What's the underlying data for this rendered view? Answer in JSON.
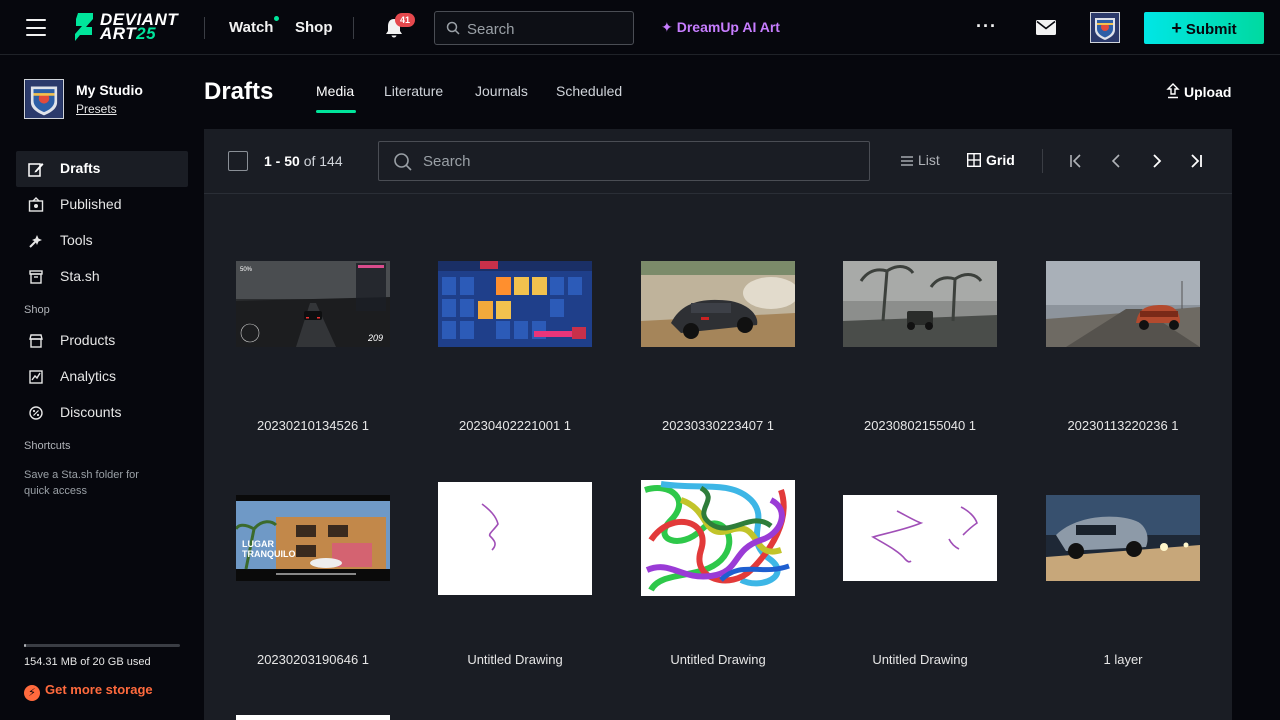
{
  "topbar": {
    "logo_line1": "DEVIANT",
    "logo_line2": "ART",
    "logo_num": "25",
    "watch": "Watch",
    "shop": "Shop",
    "notif_count": "41",
    "search_placeholder": "Search",
    "dreamup": "DreamUp AI Art",
    "more": "···",
    "submit": "Submit"
  },
  "sidebar": {
    "title": "My Studio",
    "presets": "Presets",
    "items": [
      {
        "label": "Drafts",
        "icon": "drafts-icon",
        "active": true
      },
      {
        "label": "Published",
        "icon": "published-icon"
      },
      {
        "label": "Tools",
        "icon": "tools-icon"
      },
      {
        "label": "Sta.sh",
        "icon": "stash-icon"
      }
    ],
    "shop_head": "Shop",
    "shop_items": [
      {
        "label": "Products",
        "icon": "products-icon"
      },
      {
        "label": "Analytics",
        "icon": "analytics-icon"
      },
      {
        "label": "Discounts",
        "icon": "discounts-icon"
      }
    ],
    "shortcuts_head": "Shortcuts",
    "shortcut_note": "Save a Sta.sh folder for quick access",
    "storage_fraction": 0.0075,
    "storage_text": "154.31 MB of 20 GB used",
    "more_storage": "Get more storage"
  },
  "main": {
    "title": "Drafts",
    "tabs": [
      "Media",
      "Literature",
      "Journals",
      "Scheduled"
    ],
    "active_tab": "Media",
    "upload": "Upload"
  },
  "toolbar": {
    "range_bold": "1 - 50",
    "range_rest": " of 144",
    "search_placeholder": "Search",
    "list": "List",
    "grid": "Grid"
  },
  "items": [
    {
      "title": "20230210134526 1",
      "kind": "race-night"
    },
    {
      "title": "20230402221001 1",
      "kind": "car-menu"
    },
    {
      "title": "20230330223407 1",
      "kind": "mini-dust"
    },
    {
      "title": "20230802155040 1",
      "kind": "storm"
    },
    {
      "title": "20230113220236 1",
      "kind": "road-red"
    },
    {
      "title": "20230203190646 1",
      "kind": "building"
    },
    {
      "title": "Untitled Drawing",
      "kind": "scribble-1"
    },
    {
      "title": "Untitled Drawing",
      "kind": "scribble-color"
    },
    {
      "title": "Untitled Drawing",
      "kind": "scribble-2"
    },
    {
      "title": "1 layer",
      "kind": "car-night"
    }
  ],
  "colors": {
    "accent": "#00e59b",
    "dreamup": "#c77dff",
    "storage": "#ff6a3d",
    "badge": "#e5484d",
    "panel": "#1a1d24"
  }
}
